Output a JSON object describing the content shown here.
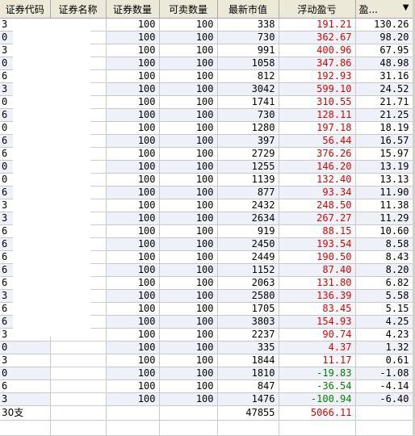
{
  "columns": {
    "code": "证券代码",
    "name": "证券名称",
    "qty": "证券数量",
    "sellable": "可卖数量",
    "mkt": "最新市值",
    "pnl": "浮动盈亏",
    "pct": "盈...",
    "sort_arrow": "▼"
  },
  "rows": [
    {
      "code": "3",
      "qty": "100",
      "sellable": "100",
      "mkt": "338",
      "pnl": "191.21",
      "pct": "130.26"
    },
    {
      "code": "0",
      "qty": "100",
      "sellable": "100",
      "mkt": "730",
      "pnl": "362.67",
      "pct": "98.20"
    },
    {
      "code": "3",
      "qty": "100",
      "sellable": "100",
      "mkt": "991",
      "pnl": "400.96",
      "pct": "67.95"
    },
    {
      "code": "0",
      "qty": "100",
      "sellable": "100",
      "mkt": "1058",
      "pnl": "347.86",
      "pct": "48.98"
    },
    {
      "code": "6",
      "qty": "100",
      "sellable": "100",
      "mkt": "812",
      "pnl": "192.93",
      "pct": "31.16"
    },
    {
      "code": "3",
      "qty": "100",
      "sellable": "100",
      "mkt": "3042",
      "pnl": "599.10",
      "pct": "24.52"
    },
    {
      "code": "0",
      "qty": "100",
      "sellable": "100",
      "mkt": "1741",
      "pnl": "310.55",
      "pct": "21.71"
    },
    {
      "code": "6",
      "qty": "100",
      "sellable": "100",
      "mkt": "730",
      "pnl": "128.11",
      "pct": "21.25"
    },
    {
      "code": "0",
      "qty": "100",
      "sellable": "100",
      "mkt": "1280",
      "pnl": "197.18",
      "pct": "18.19"
    },
    {
      "code": "6",
      "qty": "100",
      "sellable": "100",
      "mkt": "397",
      "pnl": "56.44",
      "pct": "16.57"
    },
    {
      "code": "6",
      "qty": "100",
      "sellable": "100",
      "mkt": "2729",
      "pnl": "376.26",
      "pct": "15.97"
    },
    {
      "code": "0",
      "qty": "100",
      "sellable": "100",
      "mkt": "1255",
      "pnl": "146.20",
      "pct": "13.19"
    },
    {
      "code": "0",
      "qty": "100",
      "sellable": "100",
      "mkt": "1139",
      "pnl": "132.40",
      "pct": "13.13"
    },
    {
      "code": "6",
      "qty": "100",
      "sellable": "100",
      "mkt": "877",
      "pnl": "93.34",
      "pct": "11.90"
    },
    {
      "code": "3",
      "qty": "100",
      "sellable": "100",
      "mkt": "2432",
      "pnl": "248.50",
      "pct": "11.38"
    },
    {
      "code": "3",
      "qty": "100",
      "sellable": "100",
      "mkt": "2634",
      "pnl": "267.27",
      "pct": "11.29"
    },
    {
      "code": "6",
      "qty": "100",
      "sellable": "100",
      "mkt": "919",
      "pnl": "88.15",
      "pct": "10.60"
    },
    {
      "code": "6",
      "qty": "100",
      "sellable": "100",
      "mkt": "2450",
      "pnl": "193.54",
      "pct": "8.58"
    },
    {
      "code": "6",
      "qty": "100",
      "sellable": "100",
      "mkt": "2449",
      "pnl": "190.50",
      "pct": "8.43"
    },
    {
      "code": "6",
      "qty": "100",
      "sellable": "100",
      "mkt": "1152",
      "pnl": "87.40",
      "pct": "8.20"
    },
    {
      "code": "6",
      "qty": "100",
      "sellable": "100",
      "mkt": "2063",
      "pnl": "131.80",
      "pct": "6.82"
    },
    {
      "code": "3",
      "qty": "100",
      "sellable": "100",
      "mkt": "2580",
      "pnl": "136.39",
      "pct": "5.58"
    },
    {
      "code": "6",
      "qty": "100",
      "sellable": "100",
      "mkt": "1705",
      "pnl": "83.45",
      "pct": "5.15"
    },
    {
      "code": "6",
      "qty": "100",
      "sellable": "100",
      "mkt": "3803",
      "pnl": "154.93",
      "pct": "4.25"
    },
    {
      "code": "3",
      "qty": "100",
      "sellable": "100",
      "mkt": "2237",
      "pnl": "90.74",
      "pct": "4.23"
    },
    {
      "code": "0",
      "qty": "100",
      "sellable": "100",
      "mkt": "335",
      "pnl": "4.37",
      "pct": "1.32"
    },
    {
      "code": "3",
      "qty": "100",
      "sellable": "100",
      "mkt": "1844",
      "pnl": "11.17",
      "pct": "0.61"
    },
    {
      "code": "0",
      "qty": "100",
      "sellable": "100",
      "mkt": "1810",
      "pnl": "-19.83",
      "pct": "-1.08"
    },
    {
      "code": "6",
      "qty": "100",
      "sellable": "100",
      "mkt": "847",
      "pnl": "-36.54",
      "pct": "-4.14"
    },
    {
      "code": "3",
      "qty": "100",
      "sellable": "100",
      "mkt": "1476",
      "pnl": "-100.94",
      "pct": "-6.40"
    }
  ],
  "footer": {
    "count": "30支",
    "total_mkt": "47855",
    "total_pnl": "5066.11"
  },
  "colors": {
    "positive": "#e00000",
    "negative": "#008000",
    "header_bg": "#ece9d8",
    "stripe": "#eef2f8"
  }
}
